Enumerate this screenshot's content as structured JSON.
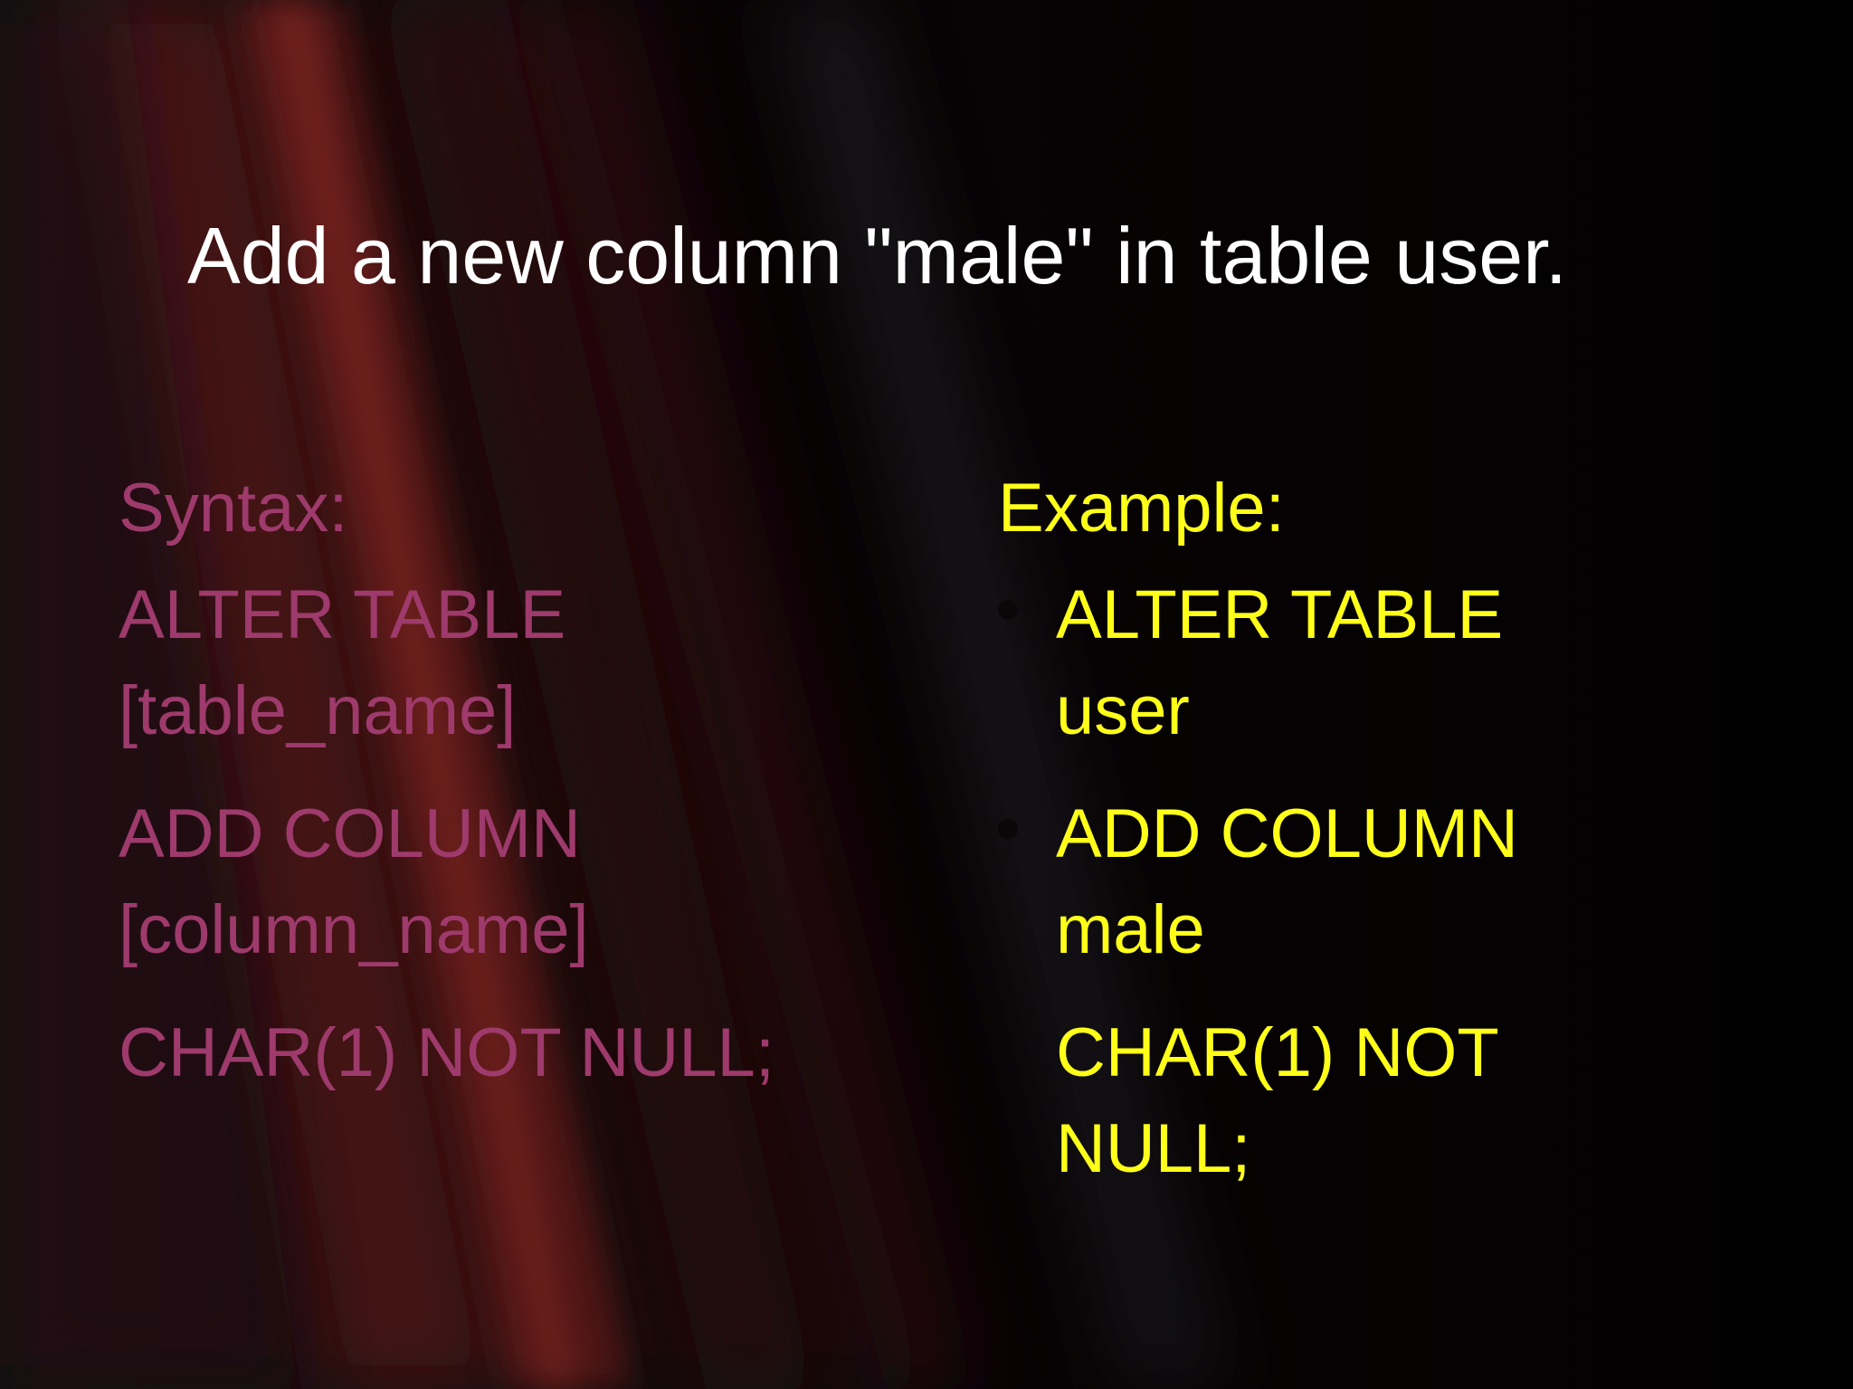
{
  "slide": {
    "title": "Add a new column \"male\" in table user."
  },
  "syntax": {
    "heading": "Syntax:",
    "lines": [
      [
        "ALTER TABLE",
        "[table_name]"
      ],
      [
        "ADD COLUMN",
        "[column_name]"
      ],
      [
        "CHAR(1) NOT NULL;"
      ]
    ],
    "color": "#9e3a6c"
  },
  "example": {
    "heading": "Example:",
    "items": [
      {
        "bullet": true,
        "lines": [
          "ALTER TABLE",
          "user"
        ]
      },
      {
        "bullet": true,
        "lines": [
          "ADD COLUMN",
          "male"
        ]
      },
      {
        "bullet": false,
        "lines": [
          "CHAR(1) NOT",
          "NULL;"
        ]
      }
    ],
    "color": "#ffff1a"
  }
}
